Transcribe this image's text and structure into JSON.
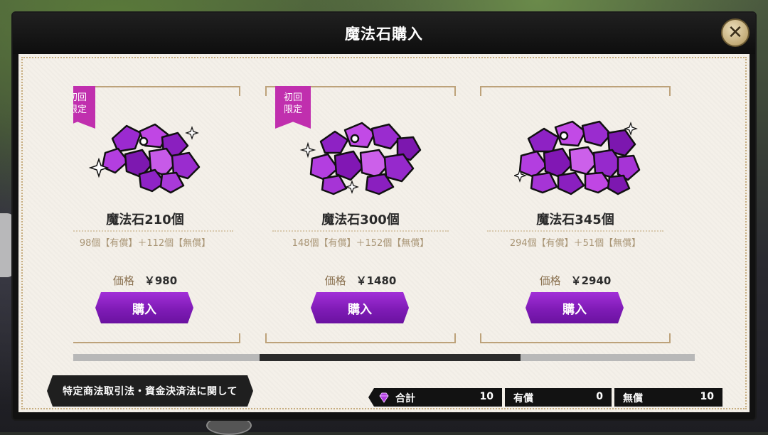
{
  "header": {
    "title": "魔法石購入"
  },
  "close": {
    "label": "✕"
  },
  "products": [
    {
      "badge": "初回\n限定",
      "has_badge": true,
      "name": "魔法石210個",
      "breakdown": "98個【有償】＋112個【無償】",
      "price_label": "価格",
      "price": "￥980",
      "buy_label": "購入"
    },
    {
      "badge": "初回\n限定",
      "has_badge": true,
      "name": "魔法石300個",
      "breakdown": "148個【有償】＋152個【無償】",
      "price_label": "価格",
      "price": "￥1480",
      "buy_label": "購入"
    },
    {
      "badge": "",
      "has_badge": false,
      "name": "魔法石345個",
      "breakdown": "294個【有償】＋51個【無償】",
      "price_label": "価格",
      "price": "￥2940",
      "buy_label": "購入"
    }
  ],
  "scroll": {
    "thumb_start_fraction": 0.3,
    "thumb_end_fraction": 0.72
  },
  "legal_button": {
    "label": "特定商法取引法・資金決済法に関して"
  },
  "totals": {
    "total": {
      "label": "合計",
      "value": "10"
    },
    "paid": {
      "label": "有償",
      "value": "0"
    },
    "free": {
      "label": "無償",
      "value": "10"
    }
  },
  "colors": {
    "accent_purple": "#8a22c4",
    "badge_magenta": "#c02fae",
    "frame_gold": "#c3a878"
  },
  "icons": {
    "close": "close-icon",
    "gem": "magic-stone-icon"
  }
}
